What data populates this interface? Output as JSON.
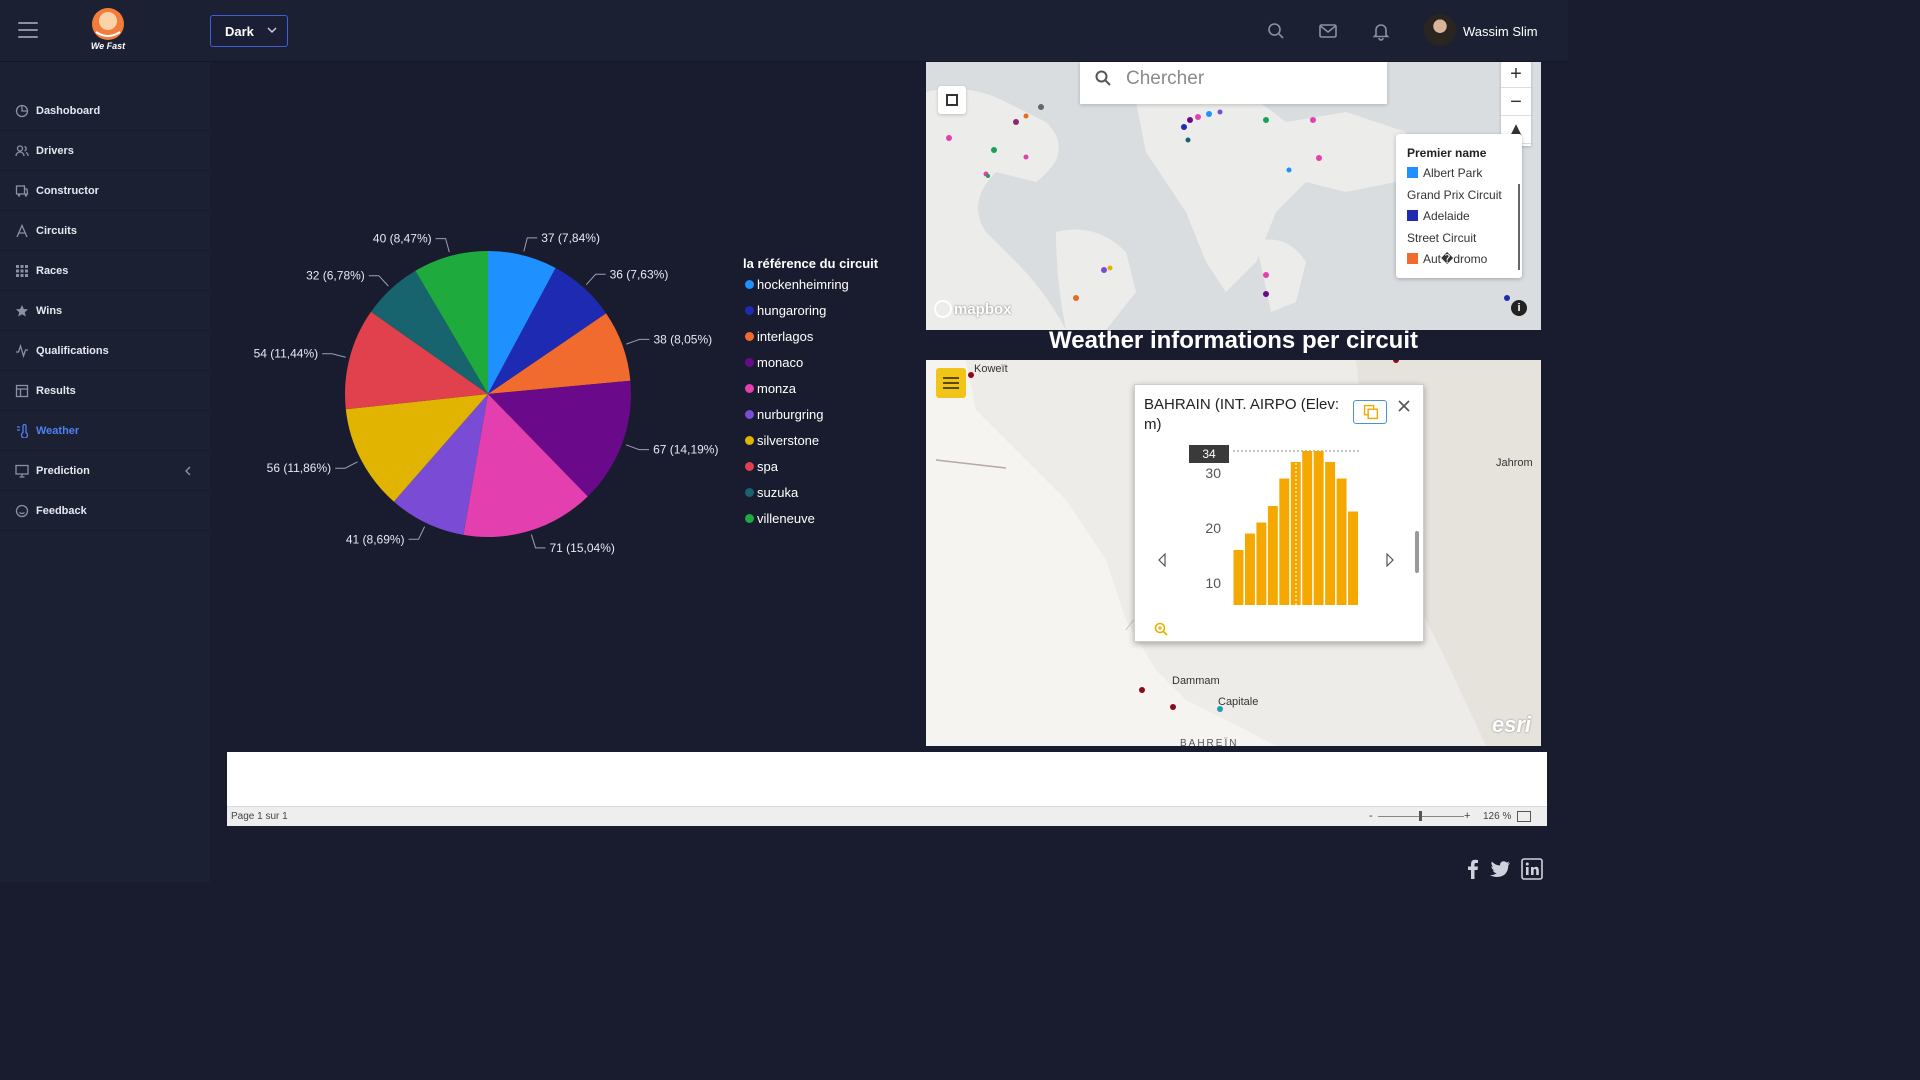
{
  "header": {
    "logo_text": "We Fast",
    "theme": "Dark",
    "user_name": "Wassim Slim"
  },
  "sidebar": {
    "items": [
      {
        "label": "Dashoboard",
        "icon": "dashboard-icon"
      },
      {
        "label": "Drivers",
        "icon": "users-icon"
      },
      {
        "label": "Constructor",
        "icon": "car-icon"
      },
      {
        "label": "Circuits",
        "icon": "circuit-icon"
      },
      {
        "label": "Races",
        "icon": "grid-icon"
      },
      {
        "label": "Wins",
        "icon": "star-icon"
      },
      {
        "label": "Qualifications",
        "icon": "activity-icon"
      },
      {
        "label": "Results",
        "icon": "table-icon"
      },
      {
        "label": "Weather",
        "icon": "thermometer-icon"
      },
      {
        "label": "Prediction",
        "icon": "monitor-icon"
      },
      {
        "label": "Feedback",
        "icon": "feedback-icon"
      }
    ],
    "active": "Weather"
  },
  "chart_data": [
    {
      "type": "pie",
      "legend_title": "la référence du circuit",
      "categories": [
        "hockenheimring",
        "hungaroring",
        "interlagos",
        "monaco",
        "monza",
        "nurburgring",
        "silverstone",
        "spa",
        "suzuka",
        "villeneuve"
      ],
      "values": [
        37,
        36,
        38,
        67,
        71,
        41,
        56,
        54,
        32,
        40
      ],
      "labels": [
        "37 (7,84%)",
        "36 (7,63%)",
        "38 (8,05%)",
        "67 (14,19%)",
        "71 (15,04%)",
        "41 (8,69%)",
        "56 (11,86%)",
        "54 (11,44%)",
        "32 (6,78%)",
        "40 (8,47%)"
      ],
      "colors": [
        "#1e90ff",
        "#1f2ab3",
        "#f26b2e",
        "#6a0a8a",
        "#e43fae",
        "#7a4bd4",
        "#e0b400",
        "#e0414d",
        "#17636e",
        "#1eaa3c"
      ]
    },
    {
      "type": "bar",
      "title": "BAHRAIN (INT. AIRPO (Elev:  m)",
      "yticks": [
        10,
        20,
        30
      ],
      "ylim": [
        6,
        34
      ],
      "values": [
        16,
        19,
        21,
        24,
        29,
        32,
        34,
        34,
        32,
        29,
        23
      ],
      "tooltip": "34",
      "colors": [
        "#f5a800"
      ]
    }
  ],
  "map_top": {
    "search_placeholder": "Chercher",
    "legend_title": "Premier name",
    "legend_items": [
      {
        "label": "Albert Park",
        "color": "#1e90ff"
      },
      {
        "label": "Grand Prix Circuit",
        "color": null
      },
      {
        "label": "Adelaide",
        "color": "#1f2ab3"
      },
      {
        "label": "Street Circuit",
        "color": null
      },
      {
        "label": "Aut�dromo",
        "color": "#f26b2e"
      }
    ],
    "attribution": "mapbox"
  },
  "weather": {
    "section_title": "Weather informations per circuit",
    "places": [
      "Koweït",
      "Jahrom",
      "Dammam",
      "Capitale",
      "BAHREÏN"
    ],
    "attribution": "esri"
  },
  "report": {
    "page_info": "Page 1 sur 1",
    "zoom_minus": "-",
    "zoom_plus": "+",
    "zoom_value": "126 %"
  }
}
